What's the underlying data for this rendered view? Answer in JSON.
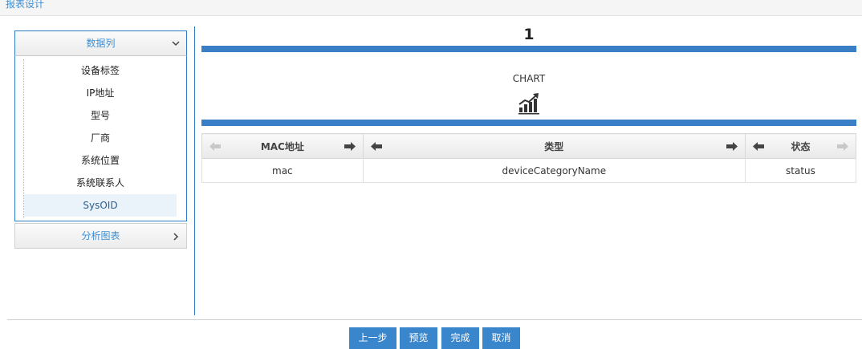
{
  "header": {
    "title": "报表设计"
  },
  "sidebar": {
    "sections": [
      {
        "label": "数据列",
        "expanded": true,
        "items": [
          {
            "label": "设备标签"
          },
          {
            "label": "IP地址"
          },
          {
            "label": "型号"
          },
          {
            "label": "厂商"
          },
          {
            "label": "系统位置"
          },
          {
            "label": "系统联系人"
          },
          {
            "label": "SysOID",
            "selected": true
          }
        ]
      },
      {
        "label": "分析图表",
        "expanded": false
      }
    ]
  },
  "report": {
    "title": "1",
    "chart_label": "CHART",
    "chart_icon": "bar-chart-growth-icon",
    "columns": [
      {
        "header": "MAC地址",
        "field": "mac",
        "left_arrow_enabled": false,
        "right_arrow_enabled": true
      },
      {
        "header": "类型",
        "field": "deviceCategoryName",
        "left_arrow_enabled": true,
        "right_arrow_enabled": true
      },
      {
        "header": "状态",
        "field": "status",
        "left_arrow_enabled": true,
        "right_arrow_enabled": false
      }
    ]
  },
  "footer": {
    "prev_label": "上一步",
    "preview_label": "预览",
    "finish_label": "完成",
    "cancel_label": "取消"
  },
  "colors": {
    "accent": "#3a86cc",
    "link_text": "#3e8fd4",
    "arrow_enabled": "#444444",
    "arrow_disabled": "#c8c8c8"
  }
}
